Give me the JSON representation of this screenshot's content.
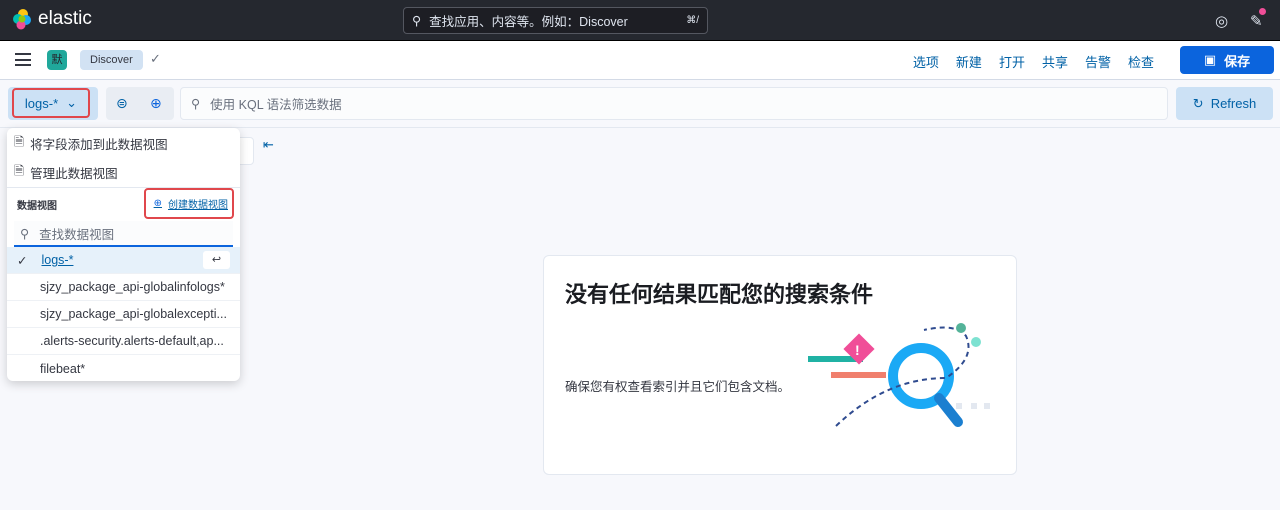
{
  "header": {
    "brand": "elastic",
    "search_placeholder": "查找应用、内容等。例如：Discover",
    "shortcut": "⌘/"
  },
  "toolbar": {
    "space": "默",
    "breadcrumb": "Discover",
    "menu": [
      "选项",
      "新建",
      "打开",
      "共享",
      "告警",
      "检查"
    ],
    "save": "保存"
  },
  "query": {
    "data_view": "logs-*",
    "placeholder": "使用 KQL 语法筛选数据",
    "refresh": "Refresh"
  },
  "popover": {
    "actions": [
      "将字段添加到此数据视图",
      "管理此数据视图"
    ],
    "section": "数据视图",
    "create": "创建数据视图",
    "search_placeholder": "查找数据视图",
    "items": [
      "logs-*",
      "sjzy_package_api-globalinfologs*",
      "sjzy_package_api-globalexcepti...",
      ".alerts-security.alerts-default,ap...",
      "filebeat*"
    ],
    "selected": "logs-*",
    "enter_key": "↩"
  },
  "empty": {
    "title": "没有任何结果匹配您的搜索条件",
    "body": "确保您有权查看索引并且它们包含文档。"
  },
  "colors": {
    "accent": "#0b64dd",
    "highlight": "#e0474c"
  }
}
